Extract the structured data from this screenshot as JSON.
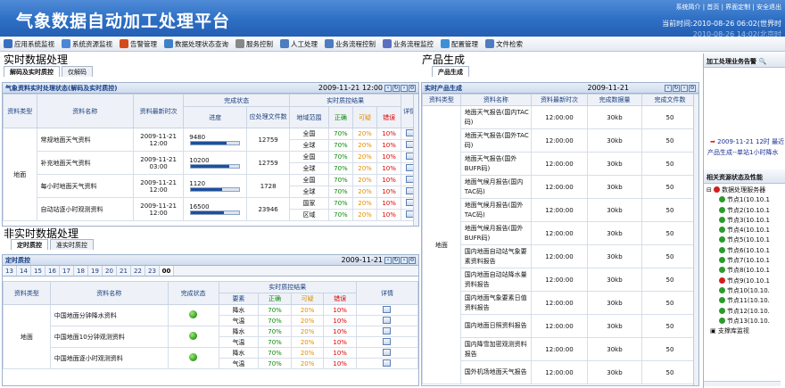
{
  "header": {
    "title": "气象数据自动加工处理平台",
    "links": "系统简介 | 首页 | 界面定制 | 安全退出",
    "time": "当前时间:2010-08-26 06:02(世界时",
    "time2": "2010-08-26 14:02(北京时"
  },
  "menu": [
    {
      "label": "应用系统监视",
      "icon": "monitor-icon",
      "color": "#3a6fc0"
    },
    {
      "label": "系统资源监视",
      "icon": "resource-icon",
      "color": "#4b86d6"
    },
    {
      "label": "告警管理",
      "icon": "alarm-icon",
      "color": "#d44a1a"
    },
    {
      "label": "数据处理状态查询",
      "icon": "query-icon",
      "color": "#3f7fc6"
    },
    {
      "label": "服务控制",
      "icon": "service-icon",
      "color": "#888888"
    },
    {
      "label": "人工处理",
      "icon": "user-icon",
      "color": "#4d7cc0"
    },
    {
      "label": "业务流程控制",
      "icon": "flow-control-icon",
      "color": "#4d7cc0"
    },
    {
      "label": "业务流程监控",
      "icon": "flow-monitor-icon",
      "color": "#5b6fc0"
    },
    {
      "label": "配置管理",
      "icon": "config-icon",
      "color": "#3f8fd8"
    },
    {
      "label": "文件检索",
      "icon": "file-search-icon",
      "color": "#4d7cc0"
    }
  ],
  "realtime": {
    "section_title": "实时数据处理",
    "tabs": [
      "解码及实时质控",
      "仅解码"
    ],
    "panel_title": "气象资料实时处理状态(解码及实时质控)",
    "date": "2009-11-21 12:00",
    "group_status": "完成状态",
    "group_qc": "实时质控结果",
    "headers": {
      "type": "资料类型",
      "name": "资料名称",
      "time": "资料最新时次",
      "progress": "进度",
      "should": "应处理文件数",
      "area": "地域范围",
      "correct": "正确",
      "suspect": "可疑",
      "error": "错误",
      "detail": "详情"
    },
    "type_label": "地面",
    "rows": [
      {
        "name": "常规地面天气资料",
        "date": "2009-11-21",
        "hour": "12:00",
        "progress_value": "9480",
        "progress": 0.74,
        "should": "12759",
        "areas": [
          {
            "area": "全国",
            "c": "70%",
            "s": "20%",
            "e": "10%"
          },
          {
            "area": "全球",
            "c": "70%",
            "s": "20%",
            "e": "10%"
          }
        ]
      },
      {
        "name": "补充地面天气资料",
        "date": "2009-11-21",
        "hour": "03:00",
        "progress_value": "10200",
        "progress": 0.8,
        "should": "12759",
        "areas": [
          {
            "area": "全国",
            "c": "70%",
            "s": "20%",
            "e": "10%"
          },
          {
            "area": "全球",
            "c": "70%",
            "s": "20%",
            "e": "10%"
          }
        ]
      },
      {
        "name": "每小时地面天气资料",
        "date": "2009-11-21",
        "hour": "12:00",
        "progress_value": "1120",
        "progress": 0.65,
        "should": "1728",
        "areas": [
          {
            "area": "全国",
            "c": "70%",
            "s": "20%",
            "e": "10%"
          },
          {
            "area": "全球",
            "c": "70%",
            "s": "20%",
            "e": "10%"
          }
        ]
      },
      {
        "name": "自动站逐小时观测资料",
        "date": "2009-11-21",
        "hour": "12:00",
        "progress_value": "16500",
        "progress": 0.69,
        "should": "23946",
        "areas": [
          {
            "area": "国家",
            "c": "70%",
            "s": "20%",
            "e": "10%"
          },
          {
            "area": "区域",
            "c": "70%",
            "s": "20%",
            "e": "10%"
          }
        ]
      }
    ]
  },
  "nonrealtime": {
    "section_title": "非实时数据处理",
    "tabs": [
      "定时质控",
      "准实时质控"
    ],
    "panel_title": "定时质控",
    "date": "2009-11-21",
    "hours": [
      "13",
      "14",
      "15",
      "16",
      "17",
      "18",
      "19",
      "20",
      "21",
      "22",
      "23",
      "00"
    ],
    "headers": {
      "type": "资料类型",
      "name": "资料名称",
      "status": "完成状态",
      "qc": "实时质控结果",
      "element": "要素",
      "correct": "正确",
      "suspect": "可疑",
      "error": "错误",
      "detail": "详情"
    },
    "type_label": "地面",
    "rows": [
      {
        "name": "中国地面分钟降水资料",
        "els": [
          {
            "el": "降水",
            "c": "70%",
            "s": "20%",
            "e": "10%"
          },
          {
            "el": "气温",
            "c": "70%",
            "s": "20%",
            "e": "10%"
          }
        ]
      },
      {
        "name": "中国地面10分钟观测资料",
        "els": [
          {
            "el": "降水",
            "c": "70%",
            "s": "20%",
            "e": "10%"
          },
          {
            "el": "气温",
            "c": "70%",
            "s": "20%",
            "e": "10%"
          }
        ]
      },
      {
        "name": "中国地面逐小时观测资料",
        "els": [
          {
            "el": "降水",
            "c": "70%",
            "s": "20%",
            "e": "10%"
          },
          {
            "el": "气温",
            "c": "70%",
            "s": "20%",
            "e": "10%"
          }
        ]
      }
    ]
  },
  "product": {
    "section_title": "产品生成",
    "tab": "产品生成",
    "panel_title": "实时产品生成",
    "date": "2009-11-21",
    "headers": {
      "type": "资料类型",
      "name": "资料名称",
      "time": "资料最新时次",
      "size": "完成数据量",
      "count": "完成文件数"
    },
    "type_label": "地面",
    "rows": [
      {
        "name": "地面天气报告(国内TAC码)",
        "time": "12:00:00",
        "size": "30kb",
        "count": "50"
      },
      {
        "name": "地面天气报告(国外TAC码)",
        "time": "12:00:00",
        "size": "30kb",
        "count": "50"
      },
      {
        "name": "地面天气报告(国外BUFR码)",
        "time": "12:00:00",
        "size": "30kb",
        "count": "50"
      },
      {
        "name": "地面气候月报告(国内TAC码)",
        "time": "12:00:00",
        "size": "30kb",
        "count": "50"
      },
      {
        "name": "地面气候月报告(国外TAC码)",
        "time": "12:00:00",
        "size": "30kb",
        "count": "50"
      },
      {
        "name": "地面气候月报告(国外BUFR码)",
        "time": "12:00:00",
        "size": "30kb",
        "count": "50"
      },
      {
        "name": "国内地面自动站气象要素资料报告",
        "time": "12:00:00",
        "size": "30kb",
        "count": "50"
      },
      {
        "name": "国内地面自动站降水量资料报告",
        "time": "12:00:00",
        "size": "30kb",
        "count": "50"
      },
      {
        "name": "国内地面气象要素日值资料报告",
        "time": "12:00:00",
        "size": "30kb",
        "count": "50"
      },
      {
        "name": "国内地面日照资料报告",
        "time": "12:00:00",
        "size": "30kb",
        "count": "50"
      },
      {
        "name": "国内降雪加密观测资料报告",
        "time": "12:00:00",
        "size": "30kb",
        "count": "50"
      },
      {
        "name": "国外机场地面天气报告",
        "time": "12:00:00",
        "size": "30kb",
        "count": "50"
      }
    ]
  },
  "side": {
    "alert_title": "加工处理业务告警",
    "alert_time": "2009-11-21 12时 最近",
    "alert_text": "产品生成--单站1小时降水",
    "res_title": "相关资源状态及性能",
    "tree_root": "数据处理服务器",
    "nodes": [
      "节点1(10.10.1",
      "节点2(10.10.1",
      "节点3(10.10.1",
      "节点4(10.10.1",
      "节点5(10.10.1",
      "节点6(10.10.1",
      "节点7(10.10.1",
      "节点8(10.10.1",
      "节点9(10.10.1",
      "节点10(10.10.",
      "节点11(10.10.",
      "节点12(10.10.",
      "节点13(10.10."
    ],
    "monitor": "支撑库监视"
  }
}
